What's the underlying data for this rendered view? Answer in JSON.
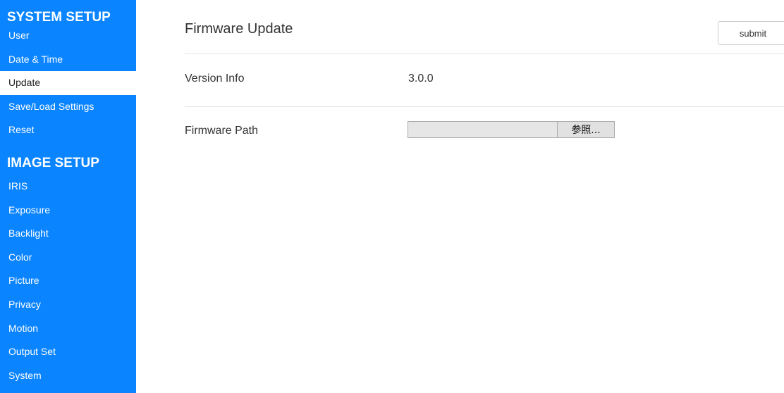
{
  "sidebar": {
    "system_setup": {
      "title": "SYSTEM SETUP",
      "items": [
        {
          "label": "User"
        },
        {
          "label": "Date & Time"
        },
        {
          "label": "Update"
        },
        {
          "label": "Save/Load Settings"
        },
        {
          "label": "Reset"
        }
      ]
    },
    "image_setup": {
      "title": "IMAGE SETUP",
      "items": [
        {
          "label": "IRIS"
        },
        {
          "label": "Exposure"
        },
        {
          "label": "Backlight"
        },
        {
          "label": "Color"
        },
        {
          "label": "Picture"
        },
        {
          "label": "Privacy"
        },
        {
          "label": "Motion"
        },
        {
          "label": "Output Set"
        },
        {
          "label": "System"
        }
      ]
    },
    "active_item": "Update",
    "colors": {
      "background": "#0a84ff",
      "text": "#ffffff",
      "active_background": "#ffffff"
    }
  },
  "main": {
    "title": "Firmware Update",
    "submit_label": "submit",
    "version": {
      "label": "Version Info",
      "value": "3.0.0"
    },
    "firmware_path": {
      "label": "Firmware Path",
      "value": "",
      "browse_label": "参照..."
    }
  }
}
